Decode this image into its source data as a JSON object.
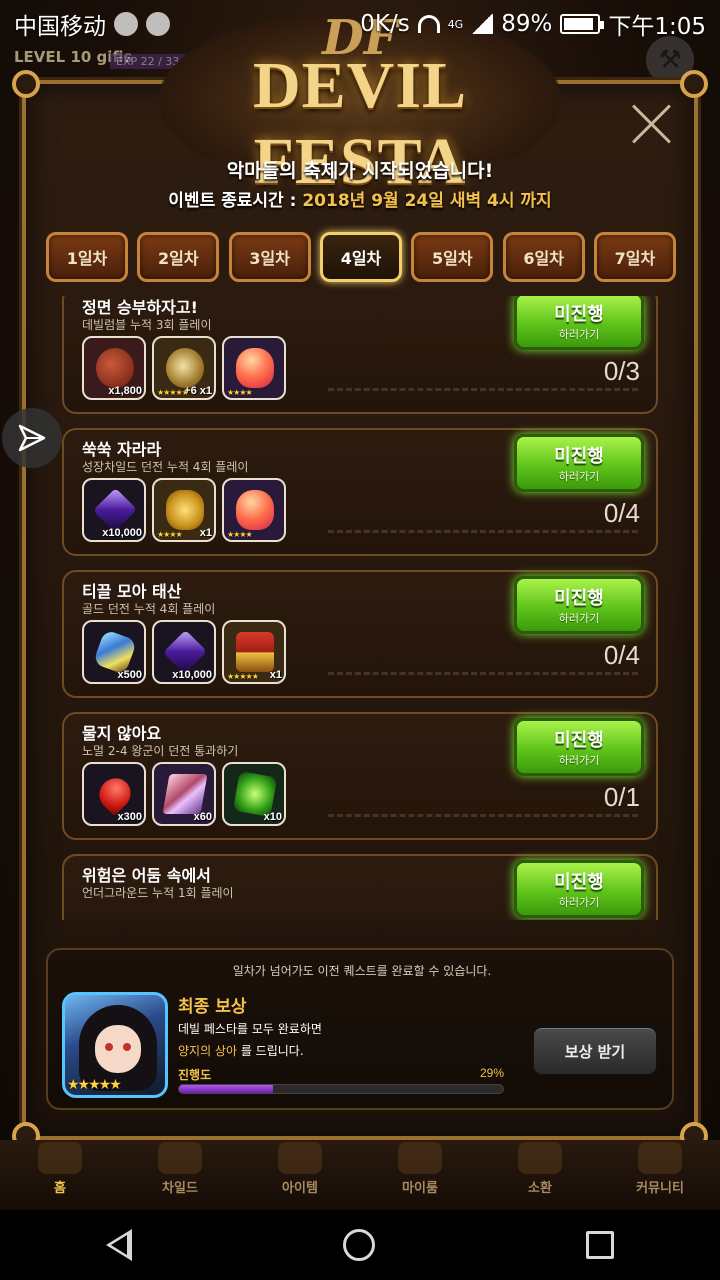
{
  "status_bar": {
    "carrier": "中国移动",
    "speed": "0K/s",
    "network": "4G",
    "battery": "89%",
    "time": "下午1:05"
  },
  "hud": {
    "level": "LEVEL 10 gifis",
    "exp": "EXP 22 / 33"
  },
  "event": {
    "logo_mark": "DF",
    "title": "DEVIL FESTA",
    "subtitle": "악마들의 축제가 시작되었습니다!",
    "end_label": "이벤트 종료시간 :",
    "end_value": "2018년 9월 24일 새벽 4시 까지"
  },
  "days": [
    "1일차",
    "2일차",
    "3일차",
    "4일차",
    "5일차",
    "6일차",
    "7일차"
  ],
  "active_day_index": 3,
  "quests": [
    {
      "title": "정면 승부하자고!",
      "desc": "데빌럼블 누적 3회 플레이",
      "button": "미진행",
      "button_sub": "하러가기",
      "progress": "0/3",
      "rewards": [
        {
          "icon": "coin-icon",
          "qty": "x1,800",
          "stars": ""
        },
        {
          "icon": "medal-icon",
          "qty": "+6 x1",
          "stars": "★★★★★"
        },
        {
          "icon": "slime-icon",
          "qty": "",
          "stars": "★★★★"
        }
      ]
    },
    {
      "title": "쑥쑥 자라라",
      "desc": "성장차일드 던전 누적 4회 플레이",
      "button": "미진행",
      "button_sub": "하러가기",
      "progress": "0/4",
      "rewards": [
        {
          "icon": "dark-gem-icon",
          "qty": "x10,000",
          "stars": ""
        },
        {
          "icon": "gold-chest-icon",
          "qty": "x1",
          "stars": "★★★★"
        },
        {
          "icon": "slime-icon",
          "qty": "",
          "stars": "★★★★"
        }
      ]
    },
    {
      "title": "티끌 모아 태산",
      "desc": "골드 던전 누적 4회 플레이",
      "button": "미진행",
      "button_sub": "하러가기",
      "progress": "0/4",
      "rewards": [
        {
          "icon": "crystal-icon",
          "qty": "x500",
          "stars": ""
        },
        {
          "icon": "dark-gem-icon",
          "qty": "x10,000",
          "stars": ""
        },
        {
          "icon": "red-chest-icon",
          "qty": "x1",
          "stars": "★★★★★"
        }
      ]
    },
    {
      "title": "물지 않아요",
      "desc": "노멀 2-4 왕군이 던전 통과하기",
      "button": "미진행",
      "button_sub": "하러가기",
      "progress": "0/1",
      "rewards": [
        {
          "icon": "heart-icon",
          "qty": "x300",
          "stars": ""
        },
        {
          "icon": "shards-icon",
          "qty": "x60",
          "stars": ""
        },
        {
          "icon": "green-cube-icon",
          "qty": "x10",
          "stars": ""
        }
      ]
    },
    {
      "title": "위험은 어둠 속에서",
      "desc": "언더그라운드 누적 1회 플레이",
      "button": "미진행",
      "button_sub": "하러가기",
      "progress": "",
      "rewards": []
    }
  ],
  "final": {
    "note": "일차가 넘어가도 이전 퀘스트를 완료할 수 있습니다.",
    "title": "최종 보상",
    "line1": "데빌 페스타를 모두 완료하면",
    "line2_highlight": "양지의 상아",
    "line2_rest": " 를 드립니다.",
    "progress_label": "진행도",
    "progress_pct": "29%",
    "progress_value": 0.29,
    "stars": "★★★★★",
    "claim_button": "보상 받기"
  },
  "game_nav": [
    "홈",
    "차일드",
    "아이템",
    "마이룸",
    "소환",
    "커뮤니티"
  ],
  "colors": {
    "accent_gold": "#f3c24c",
    "button_green": "#5fc41a",
    "progress_purple": "#8a3ad0"
  }
}
